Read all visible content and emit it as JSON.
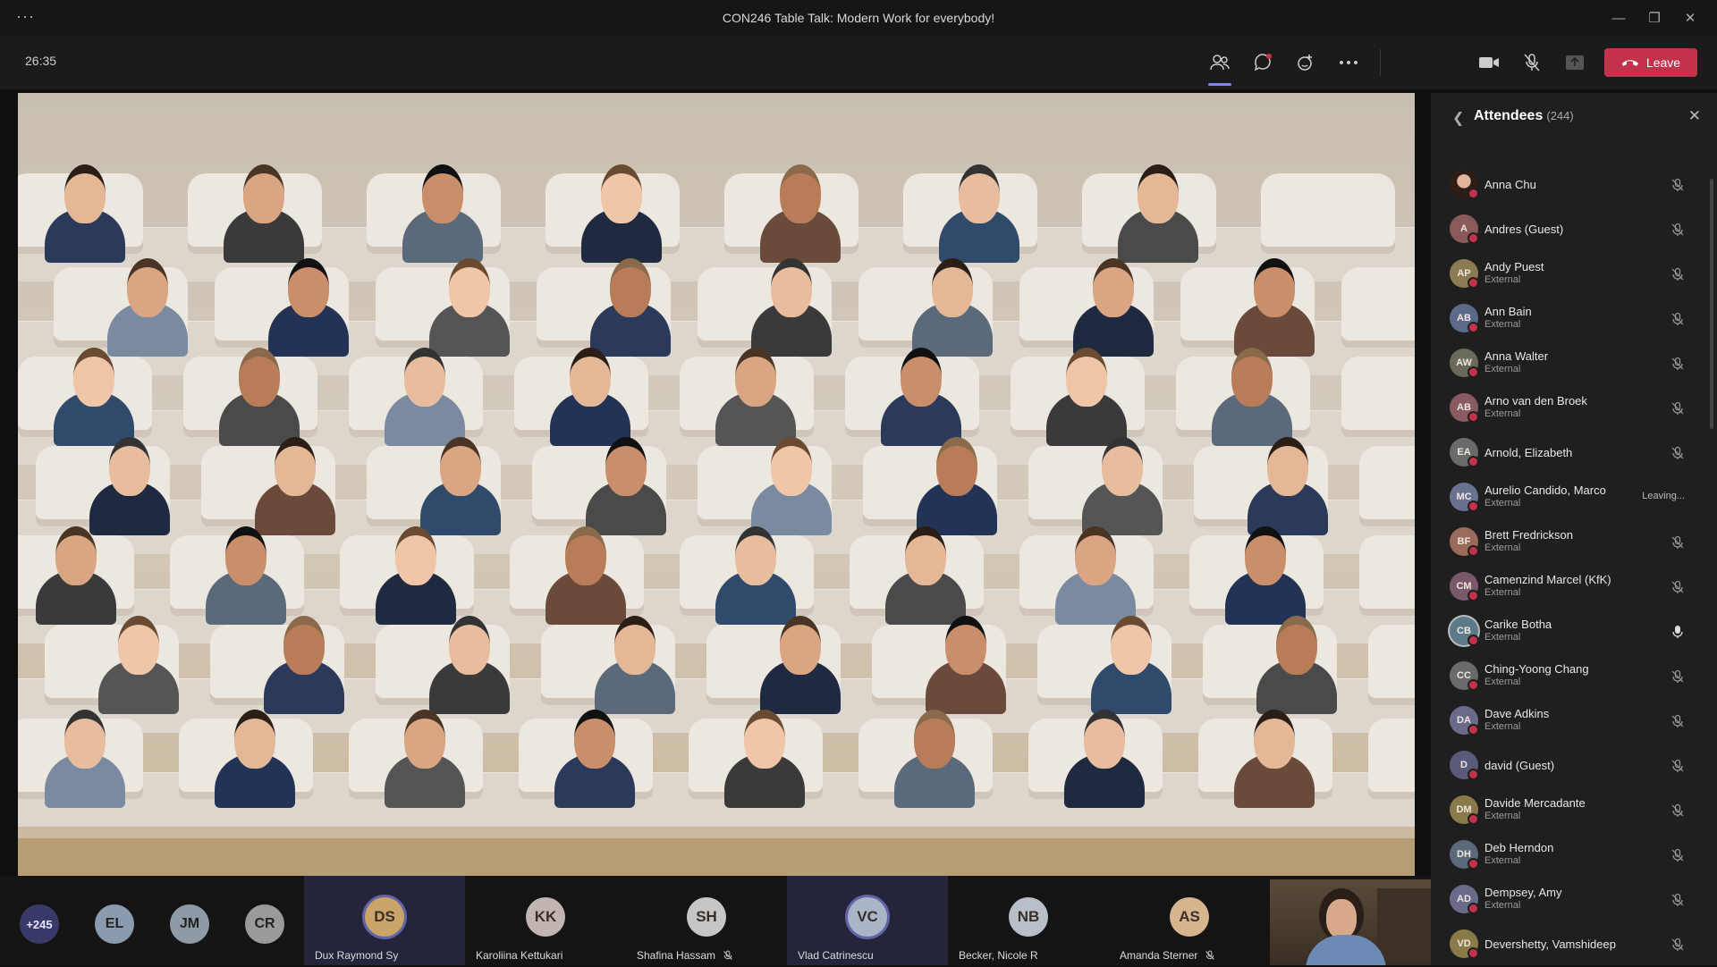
{
  "window": {
    "title": "CON246 Table Talk: Modern Work for everybody!",
    "menu_glyph": "···",
    "controls": [
      "—",
      "❐",
      "✕"
    ]
  },
  "toolbar": {
    "timer": "26:35",
    "icons": [
      "people-icon",
      "chat-icon",
      "reactions-icon",
      "more-icon"
    ],
    "media": [
      "camera-icon",
      "mic-off-icon",
      "share-icon"
    ],
    "leave_label": "Leave",
    "leave_color": "#c4314b"
  },
  "panel": {
    "title": "Attendees",
    "count": "(244)",
    "attendees": [
      {
        "name": "Anna Chu",
        "initials": "",
        "sub": "",
        "photo": true,
        "mic": "off"
      },
      {
        "name": "Andres (Guest)",
        "initials": "A",
        "sub": "",
        "mic": "off"
      },
      {
        "name": "Andy Puest",
        "initials": "AP",
        "sub": "External",
        "mic": "off"
      },
      {
        "name": "Ann Bain",
        "initials": "AB",
        "sub": "External",
        "mic": "off"
      },
      {
        "name": "Anna Walter",
        "initials": "AW",
        "sub": "External",
        "mic": "off"
      },
      {
        "name": "Arno van den Broek",
        "initials": "AB",
        "sub": "External",
        "mic": "off"
      },
      {
        "name": "Arnold, Elizabeth",
        "initials": "EA",
        "sub": "",
        "mic": "off"
      },
      {
        "name": "Aurelio Candido, Marco",
        "initials": "MC",
        "sub": "External",
        "status": "Leaving..."
      },
      {
        "name": "Brett Fredrickson",
        "initials": "BF",
        "sub": "External",
        "mic": "off"
      },
      {
        "name": "Camenzind Marcel (KfK)",
        "initials": "CM",
        "sub": "External",
        "mic": "off"
      },
      {
        "name": "Carike Botha",
        "initials": "CB",
        "sub": "External",
        "mic": "on"
      },
      {
        "name": "Ching-Yoong Chang",
        "initials": "CC",
        "sub": "External",
        "mic": "off"
      },
      {
        "name": "Dave Adkins",
        "initials": "DA",
        "sub": "External",
        "mic": "off"
      },
      {
        "name": "david (Guest)",
        "initials": "D",
        "sub": "",
        "mic": "off"
      },
      {
        "name": "Davide Mercadante",
        "initials": "DM",
        "sub": "External",
        "mic": "off"
      },
      {
        "name": "Deb Herndon",
        "initials": "DH",
        "sub": "External",
        "mic": "off"
      },
      {
        "name": "Dempsey, Amy",
        "initials": "AD",
        "sub": "External",
        "mic": "off"
      },
      {
        "name": "Devershetty, Vamshideep",
        "initials": "VD",
        "sub": "",
        "mic": "off"
      }
    ]
  },
  "strip": {
    "overflow": "+245",
    "chips": [
      "EL",
      "JM",
      "CR"
    ],
    "tiles": [
      {
        "initials": "DS",
        "name": "Dux Raymond Sy",
        "selected": true,
        "muted": false
      },
      {
        "initials": "KK",
        "name": "Karoliina Kettukari",
        "selected": false,
        "muted": false
      },
      {
        "initials": "SH",
        "name": "Shafina Hassam",
        "selected": false,
        "muted": true
      },
      {
        "initials": "VC",
        "name": "Vlad Catrinescu",
        "selected": true,
        "muted": false
      },
      {
        "initials": "NB",
        "name": "Becker, Nicole R",
        "selected": false,
        "muted": false
      },
      {
        "initials": "AS",
        "name": "Amanda Sterner",
        "selected": false,
        "muted": true
      }
    ]
  },
  "colors": {
    "accent": "#6264a7",
    "danger": "#c4314b",
    "panel_bg": "#1f1f20"
  }
}
